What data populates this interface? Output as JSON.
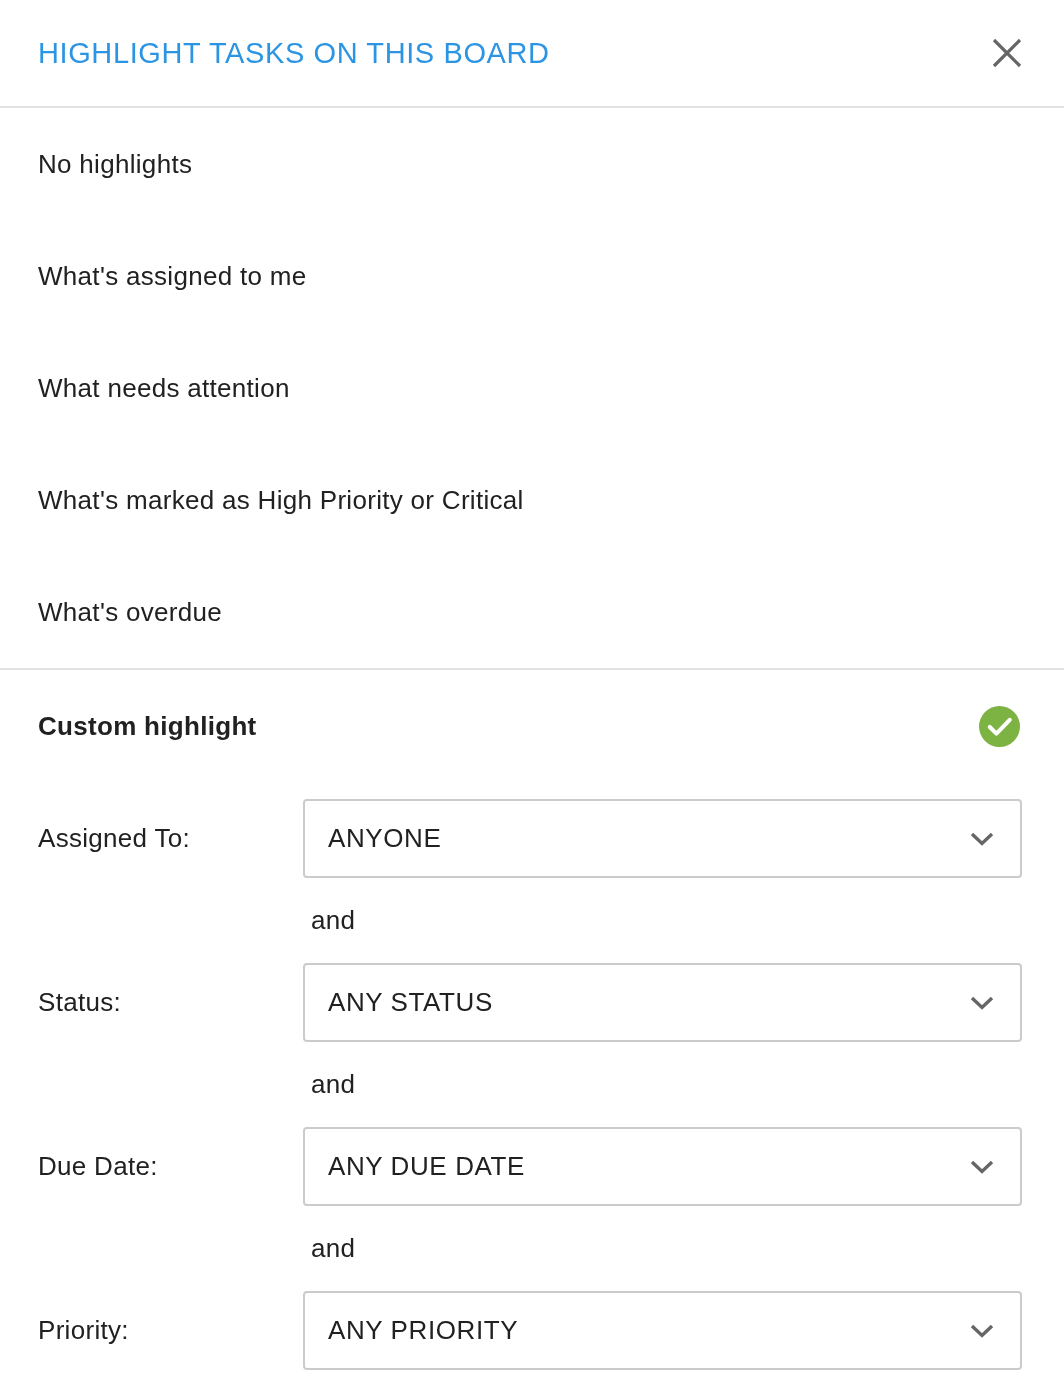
{
  "header": {
    "title": "HIGHLIGHT TASKS ON THIS BOARD"
  },
  "options": [
    {
      "label": "No highlights",
      "selected": false
    },
    {
      "label": "What's assigned to me",
      "selected": false
    },
    {
      "label": "What needs attention",
      "selected": false
    },
    {
      "label": "What's marked as High Priority or Critical",
      "selected": false
    },
    {
      "label": "What's overdue",
      "selected": false
    }
  ],
  "custom": {
    "label": "Custom highlight",
    "selected": true
  },
  "filters": [
    {
      "label": "Assigned To:",
      "value": "ANYONE",
      "connector": "and"
    },
    {
      "label": "Status:",
      "value": "ANY STATUS",
      "connector": "and"
    },
    {
      "label": "Due Date:",
      "value": "ANY DUE DATE",
      "connector": "and"
    },
    {
      "label": "Priority:",
      "value": "ANY PRIORITY"
    }
  ]
}
